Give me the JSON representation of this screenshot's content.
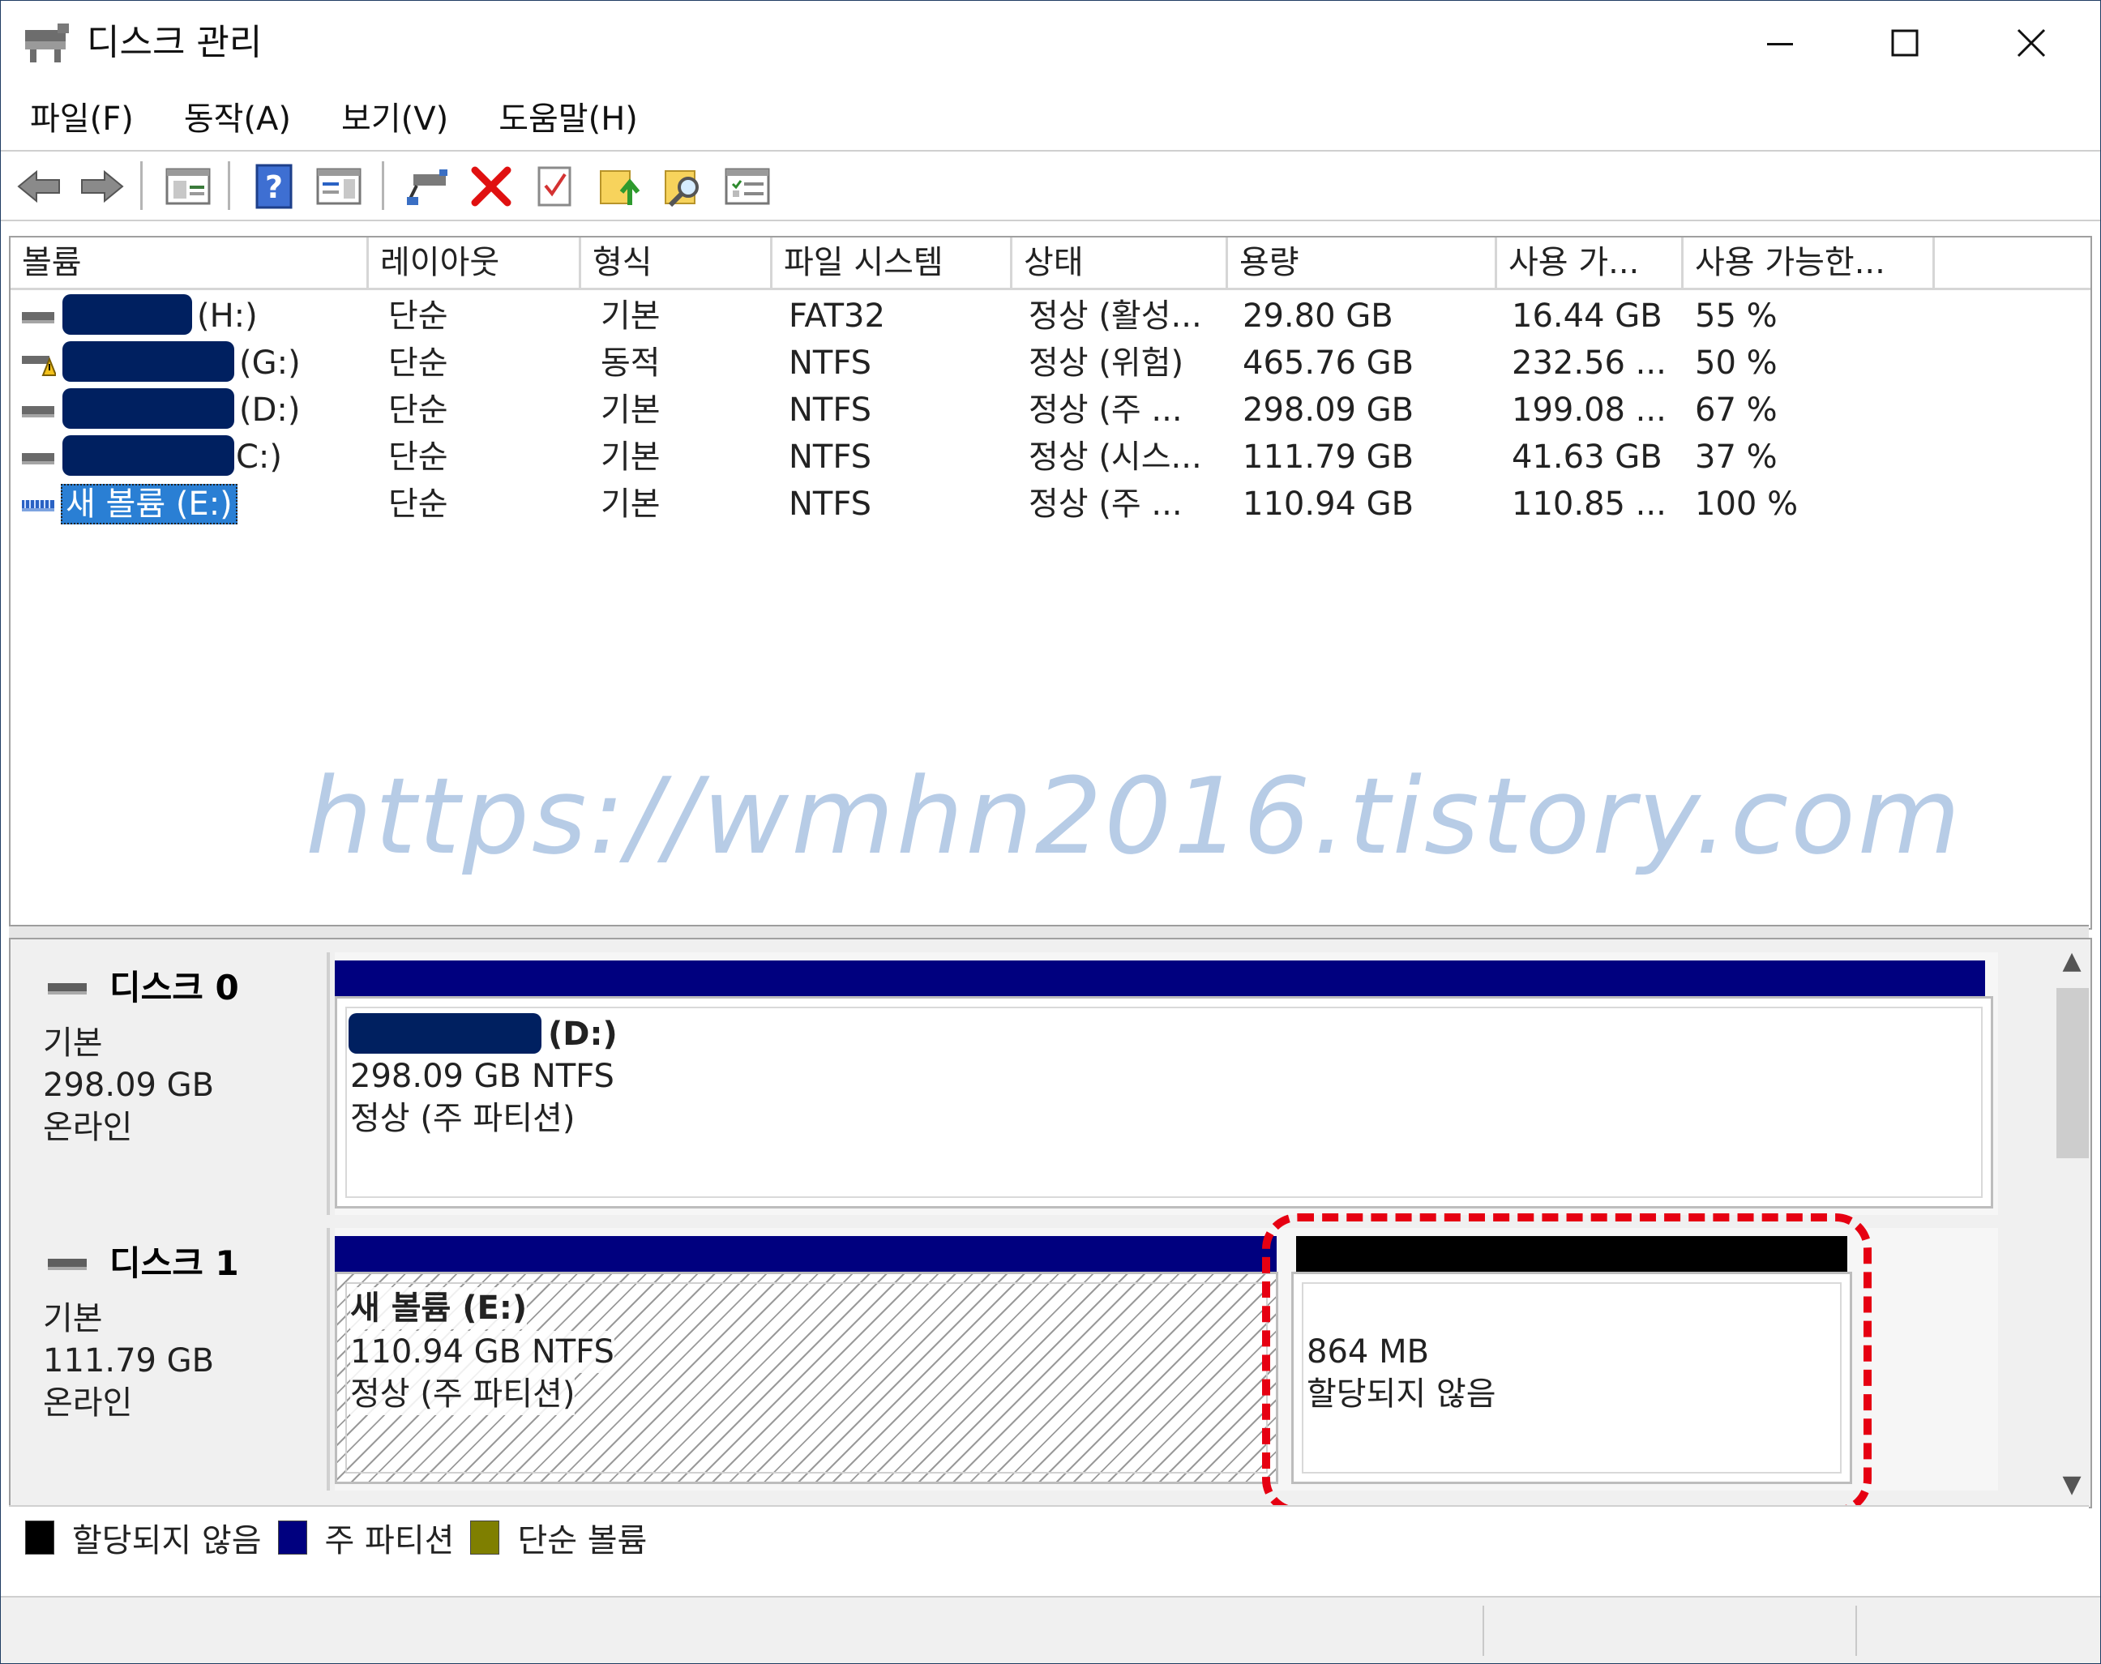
{
  "window": {
    "title": "디스크 관리"
  },
  "menu": [
    "파일(F)",
    "동작(A)",
    "보기(V)",
    "도움말(H)"
  ],
  "toolbar": {
    "icons": [
      "back-arrow-icon",
      "forward-arrow-icon",
      "console-tree-icon",
      "help-icon",
      "action-pane-icon",
      "connect-drive-icon",
      "delete-icon",
      "properties-icon",
      "folder-up-icon",
      "search-folder-icon",
      "list-view-icon"
    ]
  },
  "list": {
    "headers": [
      "볼륨",
      "레이아웃",
      "형식",
      "파일 시스템",
      "상태",
      "용량",
      "사용 가...",
      "사용 가능한..."
    ],
    "rows": [
      {
        "name": "(H:)",
        "layout": "단순",
        "type": "기본",
        "fs": "FAT32",
        "status": "정상 (활성...",
        "capacity": "29.80 GB",
        "free": "16.44 GB",
        "pct": "55 %"
      },
      {
        "name": "(G:)",
        "layout": "단순",
        "type": "동적",
        "fs": "NTFS",
        "status": "정상 (위험)",
        "capacity": "465.76 GB",
        "free": "232.56 ...",
        "pct": "50 %"
      },
      {
        "name": "(D:)",
        "layout": "단순",
        "type": "기본",
        "fs": "NTFS",
        "status": "정상 (주 ...",
        "capacity": "298.09 GB",
        "free": "199.08 ...",
        "pct": "67 %"
      },
      {
        "name": "C:)",
        "layout": "단순",
        "type": "기본",
        "fs": "NTFS",
        "status": "정상 (시스...",
        "capacity": "111.79 GB",
        "free": "41.63 GB",
        "pct": "37 %"
      },
      {
        "name": "새 볼륨 (E:)",
        "layout": "단순",
        "type": "기본",
        "fs": "NTFS",
        "status": "정상 (주 ...",
        "capacity": "110.94 GB",
        "free": "110.85 ...",
        "pct": "100 %"
      }
    ]
  },
  "watermark": "https://wmhn2016.tistory.com",
  "disks": [
    {
      "name": "디스크 0",
      "type": "기본",
      "size": "298.09 GB",
      "state": "온라인",
      "partitions": [
        {
          "label": "(D:)",
          "size": "298.09 GB NTFS",
          "status": "정상 (주 파티션)"
        }
      ]
    },
    {
      "name": "디스크 1",
      "type": "기본",
      "size": "111.79 GB",
      "state": "온라인",
      "partitions": [
        {
          "label": "새 볼륨  (E:)",
          "size": "110.94 GB NTFS",
          "status": "정상 (주 파티션)"
        },
        {
          "size": "864 MB",
          "status": "할당되지 않음"
        }
      ]
    }
  ],
  "legend": [
    {
      "label": "할당되지 않음",
      "color": "#000000"
    },
    {
      "label": "주 파티션",
      "color": "#00007f"
    },
    {
      "label": "단순 볼륨",
      "color": "#7f7f00"
    }
  ],
  "colors": {
    "primary_partition": "#00007f",
    "unallocated": "#000000",
    "simple_volume": "#7f7f00",
    "redaction": "#002060",
    "highlight": "#e60012",
    "watermark": "#b7cce6"
  }
}
